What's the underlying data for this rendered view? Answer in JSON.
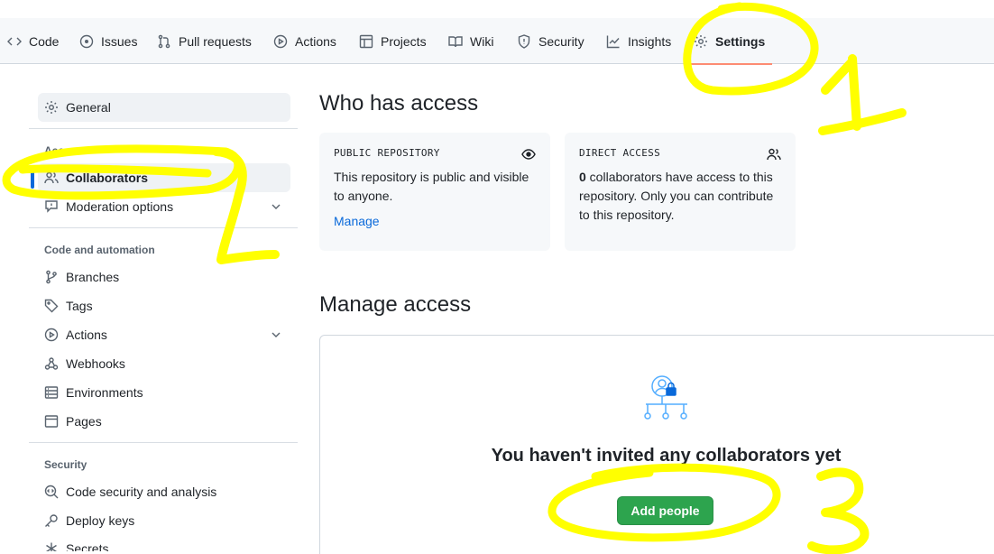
{
  "tabs": [
    {
      "label": "Code",
      "icon": "code-icon"
    },
    {
      "label": "Issues",
      "icon": "issue-icon"
    },
    {
      "label": "Pull requests",
      "icon": "pull-request-icon"
    },
    {
      "label": "Actions",
      "icon": "play-icon"
    },
    {
      "label": "Projects",
      "icon": "table-icon"
    },
    {
      "label": "Wiki",
      "icon": "book-icon"
    },
    {
      "label": "Security",
      "icon": "shield-icon"
    },
    {
      "label": "Insights",
      "icon": "graph-icon"
    },
    {
      "label": "Settings",
      "icon": "gear-icon",
      "active": true
    }
  ],
  "sidebar": {
    "general": "General",
    "groups": {
      "access": "Access",
      "code_automation": "Code and automation",
      "security": "Security"
    },
    "items": {
      "collaborators": "Collaborators",
      "moderation": "Moderation options",
      "branches": "Branches",
      "tags": "Tags",
      "actions": "Actions",
      "webhooks": "Webhooks",
      "environments": "Environments",
      "pages": "Pages",
      "code_security": "Code security and analysis",
      "deploy_keys": "Deploy keys",
      "secrets": "Secrets"
    }
  },
  "main": {
    "who_title": "Who has access",
    "public_card": {
      "label": "PUBLIC REPOSITORY",
      "text": "This repository is public and visible to anyone.",
      "link": "Manage"
    },
    "direct_card": {
      "label": "DIRECT ACCESS",
      "count": "0",
      "text": " collaborators have access to this repository. Only you can contribute to this repository."
    },
    "manage_title": "Manage access",
    "empty_title": "You haven't invited any collaborators yet",
    "add_button": "Add people"
  },
  "annotations": [
    "1",
    "2",
    "3"
  ],
  "colors": {
    "accent": "#0969da",
    "primary_button": "#2da44e",
    "active_tab_underline": "#fd8c73",
    "highlighter": "#ffff00"
  }
}
